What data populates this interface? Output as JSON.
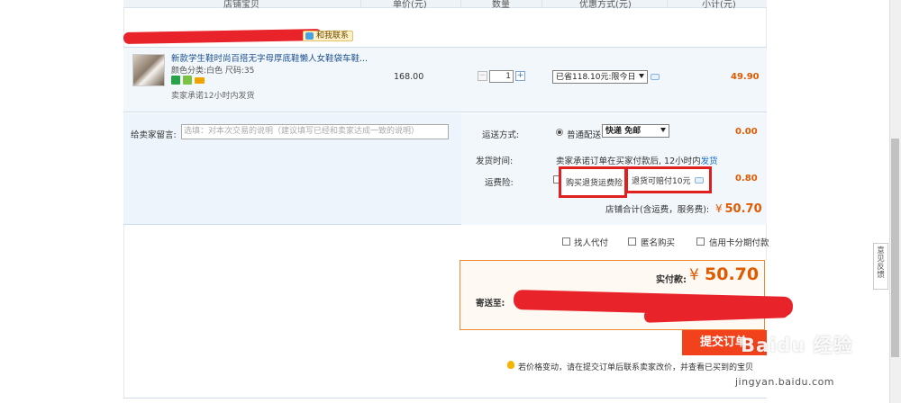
{
  "table_header": {
    "col_shop": "店铺宝贝",
    "col_price": "单价(元)",
    "col_qty": "数量",
    "col_promo": "优惠方式(元)",
    "col_subtotal": "小计(元)"
  },
  "shop": {
    "contact_label": "和我联系"
  },
  "item": {
    "title": "新款学生鞋时尚百搭无字母厚底鞋懒人女鞋袋车鞋...",
    "attrs": "颜色分类:白色   尺码:35",
    "promise": "卖家承诺12小时内发货",
    "price": "168.00",
    "quantity": "1",
    "qty_minus": "−",
    "qty_plus": "+",
    "promo_selected": "已省118.10元:限今日",
    "subtotal": "49.90"
  },
  "message": {
    "label": "给卖家留言:",
    "placeholder": "选填：对本次交易的说明（建议填写已经和卖家达成一致的说明）"
  },
  "shipping": {
    "label": "运送方式:",
    "option_label": "普通配送",
    "selected": "快递 免邮",
    "amount": "0.00"
  },
  "delivery_time": {
    "label": "发货时间:",
    "text": "卖家承诺订单在买家付款后, 12小时内",
    "link": "发货"
  },
  "return_insurance": {
    "label": "运费险:",
    "option_text": "购买退货运费险",
    "payout_text": "退货可赔付10元",
    "amount": "0.80"
  },
  "shop_total": {
    "label": "店铺合计(含运费，服务费):",
    "currency": "¥",
    "amount": "50.70"
  },
  "extras": {
    "proxy_pay": "找人代付",
    "anonymous": "匿名购买",
    "credit_installment": "信用卡分期付款"
  },
  "payment": {
    "label": "实付款:",
    "currency": "¥",
    "amount": "50.70",
    "ship_to_label": "寄送至:"
  },
  "submit": {
    "label": "提交订单"
  },
  "notice": {
    "text": "若价格变动，请在提交订单后联系卖家改价，并查看已买到的宝贝"
  },
  "watermark": {
    "brand": "Baidu 经验",
    "url": "jingyan.baidu.com"
  },
  "feedback": {
    "label": "意见反馈"
  },
  "colors": {
    "accent_orange": "#e05a00",
    "submit_red": "#f2421b",
    "highlight_red": "#e02020",
    "link_blue": "#1a6fc9"
  }
}
